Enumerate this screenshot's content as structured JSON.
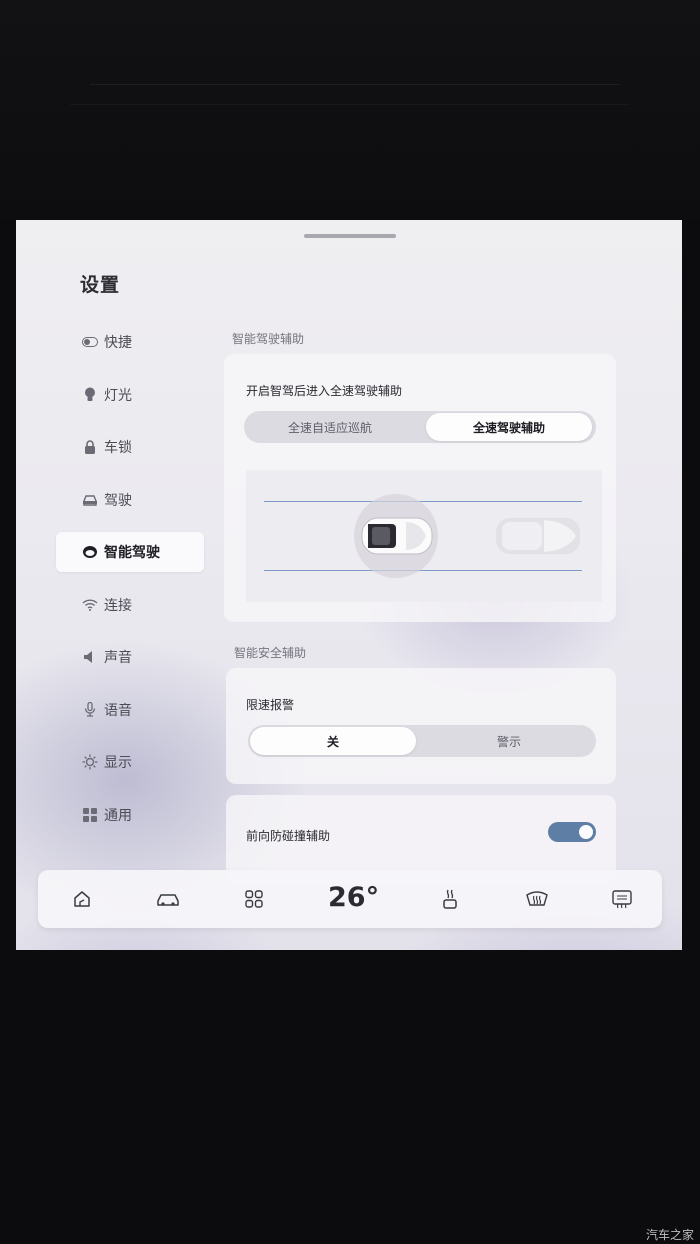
{
  "page_title": "设置",
  "sidebar": {
    "items": [
      {
        "label": "快捷",
        "icon": "toggle-icon",
        "active": false
      },
      {
        "label": "灯光",
        "icon": "bulb-icon",
        "active": false
      },
      {
        "label": "车锁",
        "icon": "lock-icon",
        "active": false
      },
      {
        "label": "驾驶",
        "icon": "car-icon",
        "active": false
      },
      {
        "label": "智能驾驶",
        "icon": "steering-icon",
        "active": true
      },
      {
        "label": "连接",
        "icon": "wifi-icon",
        "active": false
      },
      {
        "label": "声音",
        "icon": "speaker-icon",
        "active": false
      },
      {
        "label": "语音",
        "icon": "microphone-icon",
        "active": false
      },
      {
        "label": "显示",
        "icon": "brightness-icon",
        "active": false
      },
      {
        "label": "通用",
        "icon": "grid-icon",
        "active": false
      }
    ]
  },
  "smart_driving": {
    "section_label": "智能驾驶辅助",
    "card_title": "开启智驾后进入全速驾驶辅助",
    "options": [
      "全速自适应巡航",
      "全速驾驶辅助"
    ],
    "selected_index": 1
  },
  "safety": {
    "section_label": "智能安全辅助",
    "speed_limit": {
      "title": "限速报警",
      "options": [
        "关",
        "警示"
      ],
      "selected_index": 0
    },
    "forward_collision": {
      "title": "前向防碰撞辅助",
      "enabled": true
    }
  },
  "dock": {
    "temperature": "26°",
    "icons": [
      "home-icon",
      "car-icon",
      "apps-icon",
      "seat-heat-icon",
      "front-defrost-icon",
      "rear-defrost-icon"
    ]
  },
  "watermark": "汽车之家",
  "colors": {
    "accent": "#5f7ea5",
    "lane_line": "#7f9ac8"
  }
}
